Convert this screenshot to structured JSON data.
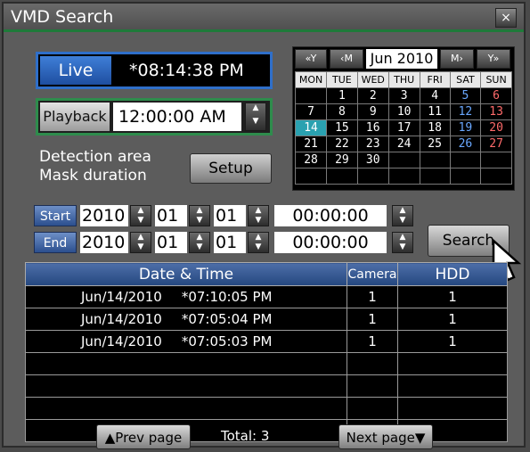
{
  "window": {
    "title": "VMD Search",
    "close_label": "×"
  },
  "live": {
    "label": "Live",
    "time": "*08:14:38 PM"
  },
  "playback": {
    "label": "Playback",
    "time": "12:00:00 AM"
  },
  "detection": {
    "line1": "Detection area",
    "line2": "Mask duration",
    "setup_label": "Setup"
  },
  "calendar": {
    "prev_year": "«Y",
    "prev_month": "‹M",
    "month": "Jun 2010",
    "next_month": "M›",
    "next_year": "Y»",
    "days": [
      "MON",
      "TUE",
      "WED",
      "THU",
      "FRI",
      "SAT",
      "SUN"
    ],
    "weeks": [
      [
        "",
        "1",
        "2",
        "3",
        "4",
        "5",
        "6"
      ],
      [
        "7",
        "8",
        "9",
        "10",
        "11",
        "12",
        "13"
      ],
      [
        "14",
        "15",
        "16",
        "17",
        "18",
        "19",
        "20"
      ],
      [
        "21",
        "22",
        "23",
        "24",
        "25",
        "26",
        "27"
      ],
      [
        "28",
        "29",
        "30",
        "",
        "",
        "",
        ""
      ],
      [
        "",
        "",
        "",
        "",
        "",
        "",
        ""
      ]
    ],
    "selected": "14"
  },
  "start": {
    "label": "Start",
    "year": "2010",
    "month": "01",
    "day": "01",
    "time": "00:00:00"
  },
  "end": {
    "label": "End",
    "year": "2010",
    "month": "01",
    "day": "01",
    "time": "00:00:00"
  },
  "search_label": "Search",
  "table": {
    "headers": {
      "datetime": "Date & Time",
      "camera": "Camera",
      "hdd": "HDD"
    },
    "rows": [
      {
        "date": "Jun/14/2010",
        "time": "*07:10:05 PM",
        "camera": "1",
        "hdd": "1"
      },
      {
        "date": "Jun/14/2010",
        "time": "*07:05:04 PM",
        "camera": "1",
        "hdd": "1"
      },
      {
        "date": "Jun/14/2010",
        "time": "*07:05:03 PM",
        "camera": "1",
        "hdd": "1"
      },
      {
        "date": "",
        "time": "",
        "camera": "",
        "hdd": ""
      },
      {
        "date": "",
        "time": "",
        "camera": "",
        "hdd": ""
      },
      {
        "date": "",
        "time": "",
        "camera": "",
        "hdd": ""
      },
      {
        "date": "",
        "time": "",
        "camera": "",
        "hdd": ""
      }
    ]
  },
  "footer": {
    "prev_label": "▲Prev page",
    "total": "Total: 3",
    "next_label": "Next page▼"
  },
  "colors": {
    "live_accent": "#2f6fc9",
    "playback_accent": "#2e8c4c",
    "selected_day": "#2aa1b0"
  }
}
